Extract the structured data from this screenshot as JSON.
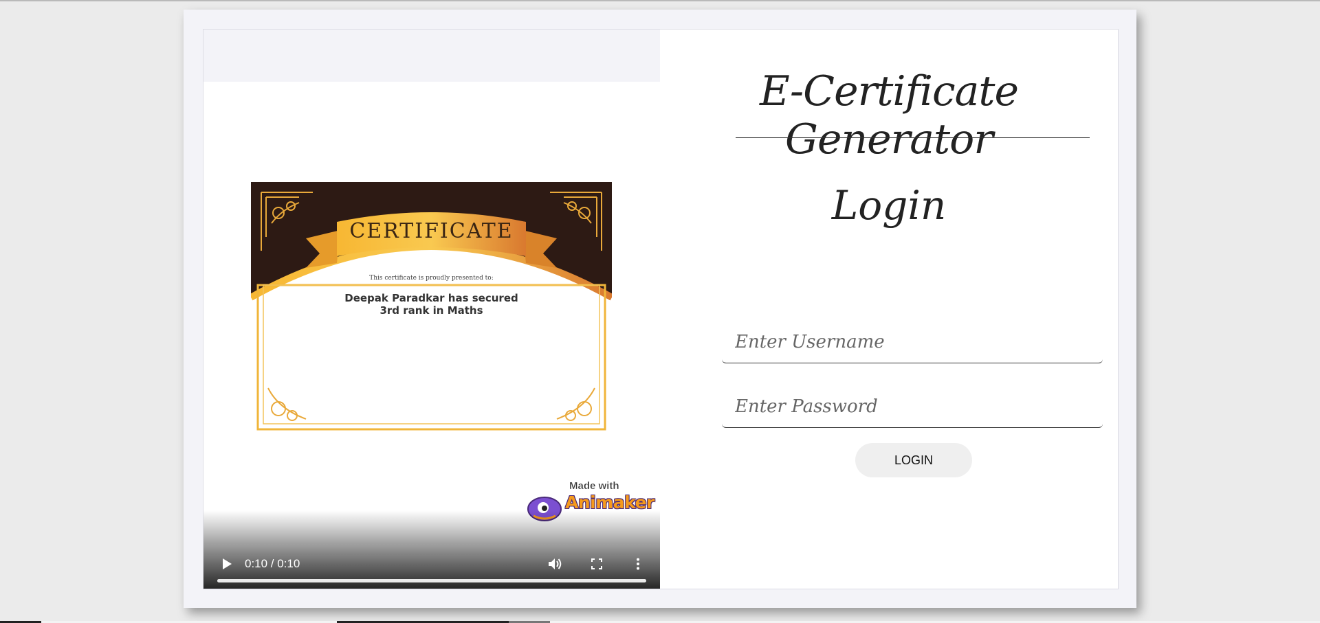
{
  "certificate": {
    "heading": "CERTIFICATE",
    "subtitle": "This certificate is proudly presented to:",
    "body": "Deepak Paradkar has secured 3rd rank in Maths"
  },
  "watermark": {
    "made_with": "Made with",
    "brand": "Animaker"
  },
  "video": {
    "time": "0:10 / 0:10",
    "progress": 1.0,
    "controls": [
      "play-icon",
      "volume-icon",
      "fullscreen-icon",
      "more-vert-icon"
    ]
  },
  "login": {
    "app_title": "E-Certificate Generator",
    "heading": "Login",
    "username_placeholder": "Enter Username",
    "password_placeholder": "Enter Password",
    "button_label": "LOGIN"
  },
  "colors": {
    "page_bg": "#ebebeb",
    "card_bg": "#f3f3f8",
    "cert_dark": "#2d1a14",
    "cert_gold": "#f0a92b",
    "button_bg": "#efefef"
  }
}
